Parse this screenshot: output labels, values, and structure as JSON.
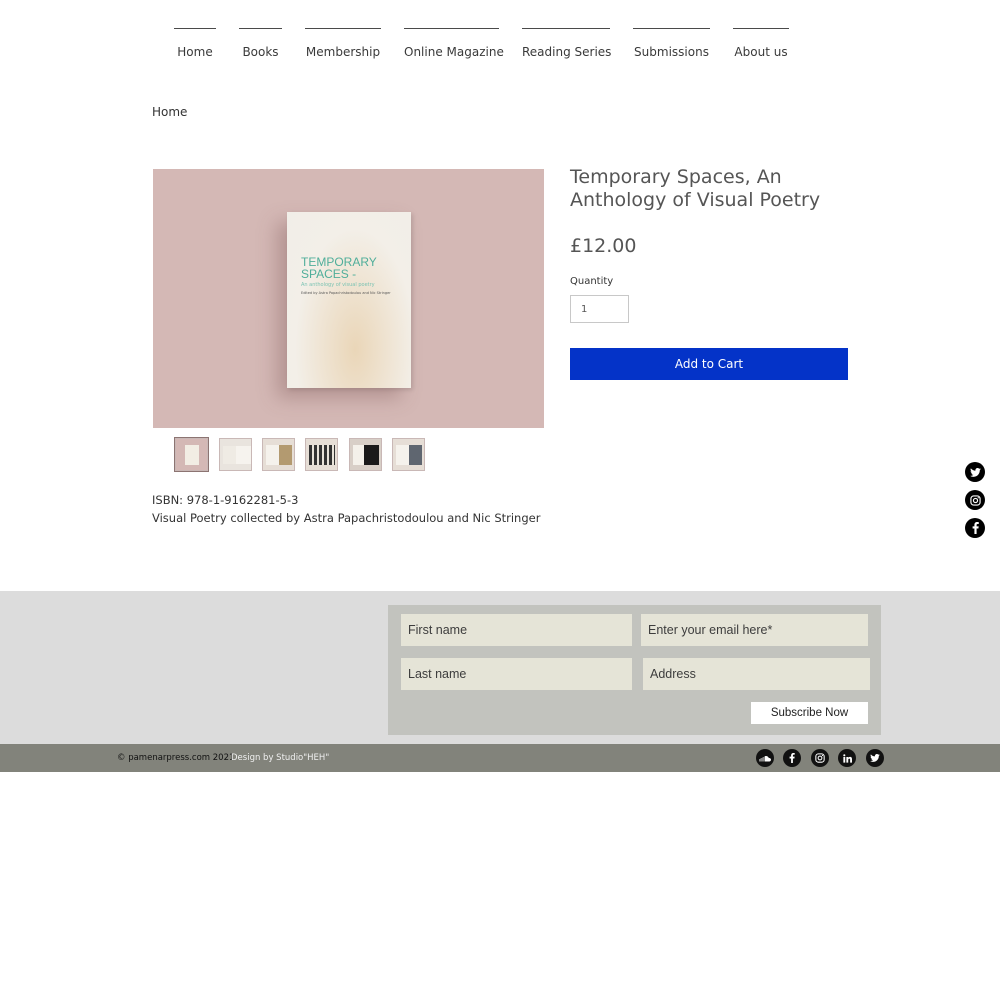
{
  "nav": {
    "items": [
      {
        "label": "Home"
      },
      {
        "label": "Books"
      },
      {
        "label": "Membership"
      },
      {
        "label": "Online Magazine"
      },
      {
        "label": "Reading Series"
      },
      {
        "label": "Submissions"
      },
      {
        "label": "About us"
      }
    ]
  },
  "breadcrumb": "Home",
  "product": {
    "title": "Temporary Spaces, An Anthology of Visual Poetry",
    "price": "£12.00",
    "quantity_label": "Quantity",
    "quantity_value": "1",
    "add_to_cart_label": "Add to Cart",
    "isbn": "ISBN: 978-1-9162281-5-3",
    "description": "Visual Poetry collected by Astra Papachristodoulou and Nic Stringer",
    "cover": {
      "title_line1": "TEMPORARY",
      "title_line2": "SPACES -",
      "subtitle": "An anthology of visual poetry",
      "editors": "Edited by Astra Papachristodoulou and Nic Stringer"
    },
    "thumbnail_count": 6,
    "selected_thumbnail": 1
  },
  "side_social": {
    "icons": [
      "twitter-icon",
      "instagram-icon",
      "facebook-icon"
    ]
  },
  "newsletter": {
    "first_name_placeholder": "First name",
    "email_placeholder": "Enter your email here*",
    "last_name_placeholder": "Last name",
    "address_placeholder": "Address",
    "subscribe_label": "Subscribe Now"
  },
  "footer": {
    "copyright": "© pamenarpress.com 2021",
    "design_credit": "Design by Studio\"HEH\"",
    "icons": [
      "soundcloud-icon",
      "facebook-icon",
      "instagram-icon",
      "linkedin-icon",
      "twitter-icon"
    ]
  },
  "colors": {
    "accent_button": "#0433c8",
    "hero_background": "#d4b8b5",
    "footer_background": "#dcdcdc",
    "bottom_bar": "#82837b"
  }
}
